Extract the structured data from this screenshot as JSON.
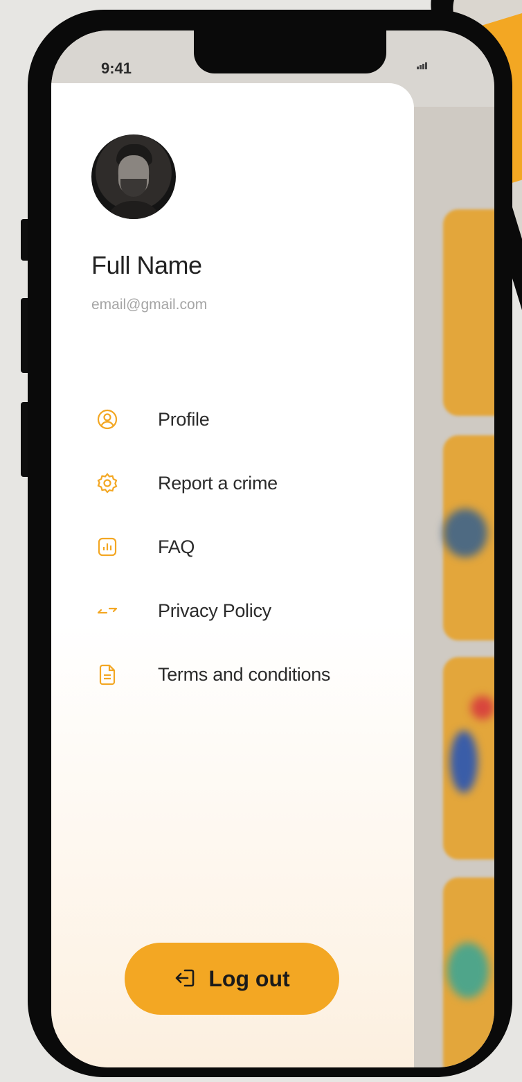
{
  "status_bar": {
    "time": "9:41"
  },
  "profile": {
    "name": "Full Name",
    "email": "email@gmail.com"
  },
  "menu": {
    "items": [
      {
        "label": "Profile",
        "icon": "user-circle-icon"
      },
      {
        "label": "Report a crime",
        "icon": "gear-icon"
      },
      {
        "label": "FAQ",
        "icon": "chart-icon"
      },
      {
        "label": "Privacy Policy",
        "icon": "swap-arrows-icon"
      },
      {
        "label": "Terms and conditions",
        "icon": "document-icon"
      }
    ]
  },
  "logout": {
    "label": "Log out",
    "icon": "logout-icon"
  },
  "colors": {
    "accent": "#f3a723",
    "text": "#2b2b2b",
    "muted": "#a5a5a5"
  }
}
